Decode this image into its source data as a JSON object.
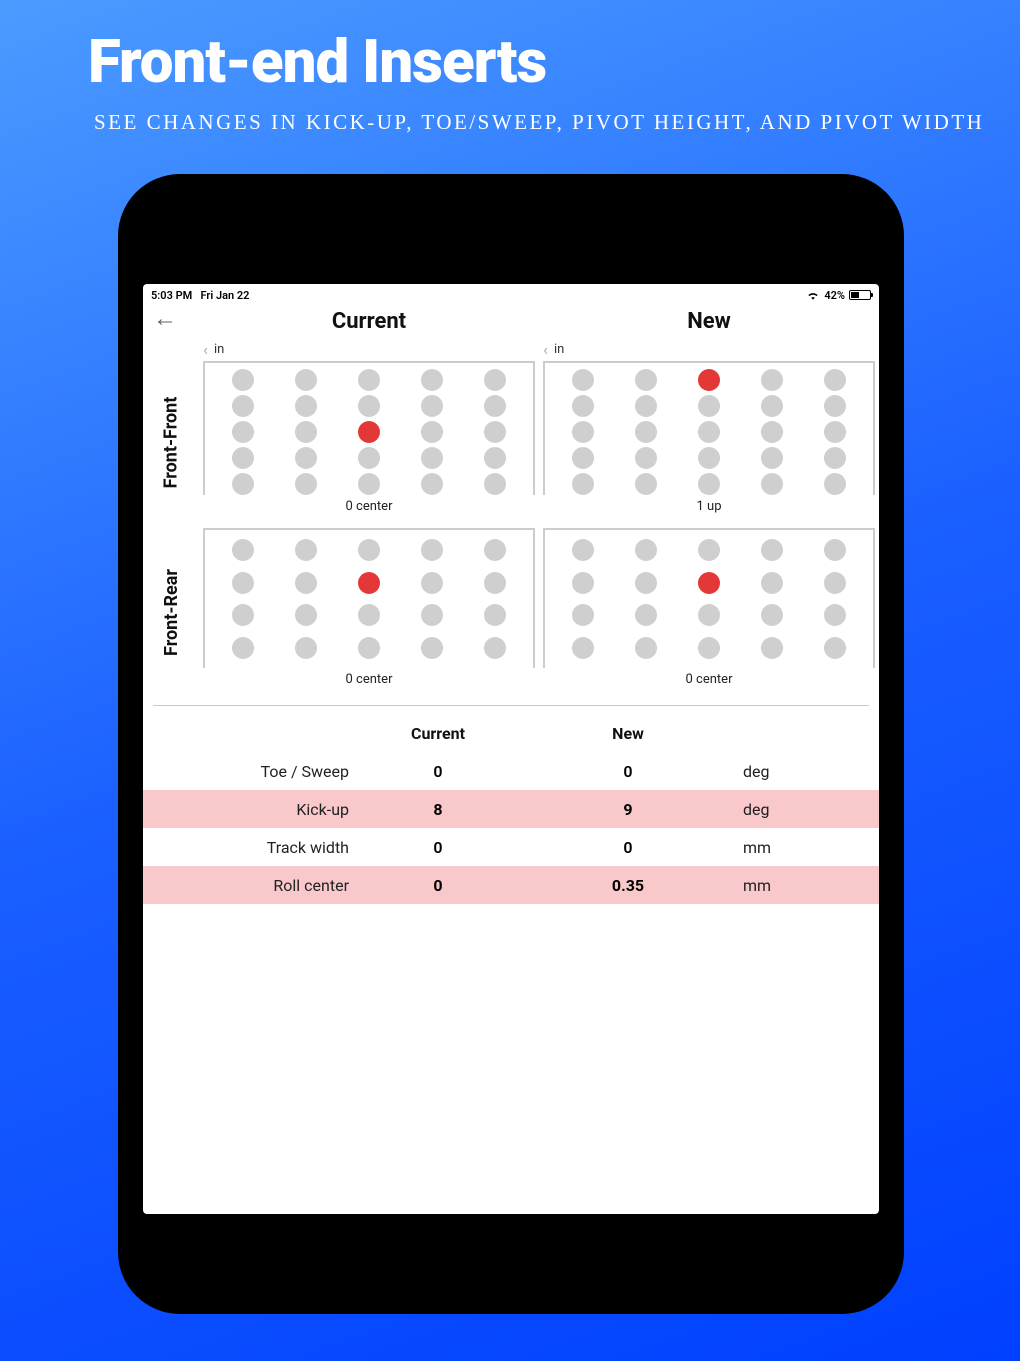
{
  "hero": {
    "title": "Front-end Inserts",
    "subtitle": "See changes in kick-up, toe/sweep, pivot height, and pivot width"
  },
  "statusbar": {
    "time": "5:03 PM",
    "date": "Fri Jan 22",
    "battery_pct": "42%"
  },
  "columns": {
    "current": "Current",
    "new": "New",
    "in_label": "in"
  },
  "panels": {
    "front_front": {
      "label": "Front-Front",
      "current": {
        "caption": "0 center",
        "selected": {
          "row": 2,
          "col": 2
        }
      },
      "new": {
        "caption": "1 up",
        "selected": {
          "row": 0,
          "col": 2
        }
      }
    },
    "front_rear": {
      "label": "Front-Rear",
      "current": {
        "caption": "0 center",
        "selected": {
          "row": 1,
          "col": 2
        }
      },
      "new": {
        "caption": "0 center",
        "selected": {
          "row": 1,
          "col": 2
        }
      }
    }
  },
  "results": {
    "headers": {
      "current": "Current",
      "new": "New"
    },
    "rows": [
      {
        "label": "Toe / Sweep",
        "current": "0",
        "new": "0",
        "unit": "deg",
        "changed": false
      },
      {
        "label": "Kick-up",
        "current": "8",
        "new": "9",
        "unit": "deg",
        "changed": true
      },
      {
        "label": "Track width",
        "current": "0",
        "new": "0",
        "unit": "mm",
        "changed": false
      },
      {
        "label": "Roll center",
        "current": "0",
        "new": "0.35",
        "unit": "mm",
        "changed": true
      }
    ]
  }
}
